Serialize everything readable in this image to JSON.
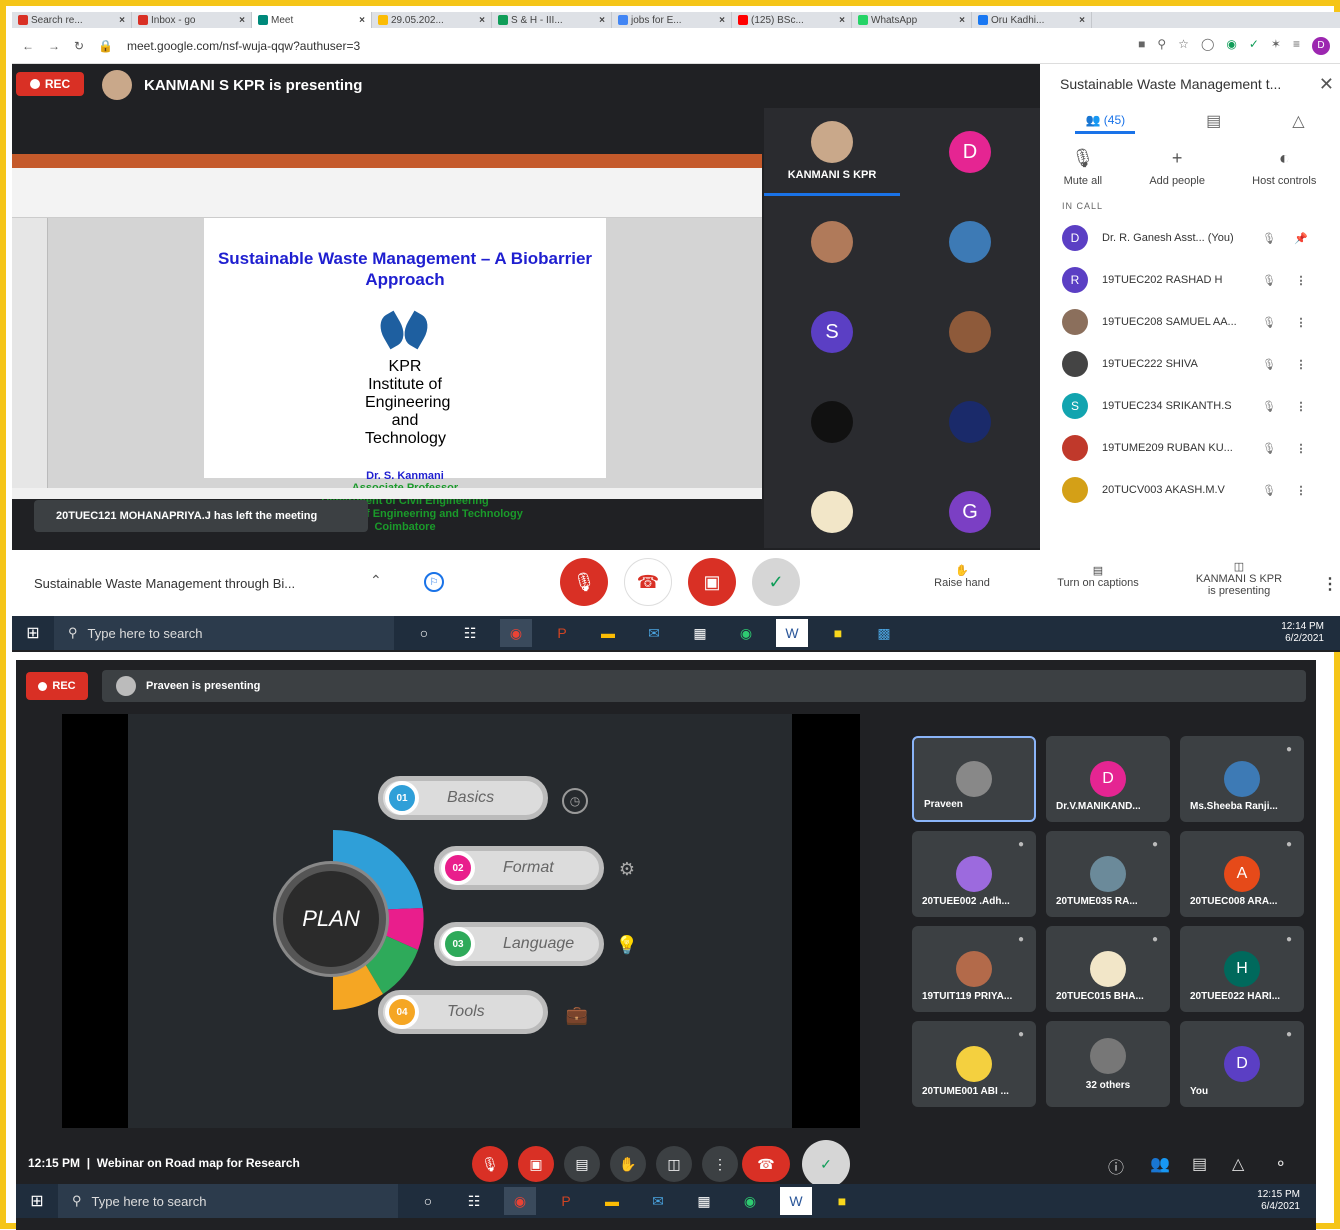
{
  "browser": {
    "tabs": [
      {
        "label": "Search re...",
        "color": "#d93025"
      },
      {
        "label": "Inbox - go",
        "color": "#d93025"
      },
      {
        "label": "Meet",
        "color": "#00897b"
      },
      {
        "label": "29.05.202...",
        "color": "#fbbc04"
      },
      {
        "label": "S & H - III...",
        "color": "#0f9d58"
      },
      {
        "label": "jobs for E...",
        "color": "#4285f4"
      },
      {
        "label": "(125) BSc...",
        "color": "#ff0000"
      },
      {
        "label": "WhatsApp",
        "color": "#25d366"
      },
      {
        "label": "Oru Kadhi...",
        "color": "#1877f2"
      }
    ],
    "url": "meet.google.com/nsf-wuja-qqw?authuser=3"
  },
  "top": {
    "rec_label": "REC",
    "presenting_text": "KANMANI S KPR is presenting",
    "slide": {
      "title": "Sustainable Waste Management – A Biobarrier Approach",
      "institute_logo_text": "KPR Institute of Engineering and Technology",
      "presenter": "Dr. S. Kanmani",
      "lines": [
        "Associate Professor",
        "Department of Civil Engineering",
        "KPR Institute of Engineering and Technology",
        "Coimbatore"
      ]
    },
    "notification": "20TUEC121 MOHANAPRIYA.J has left the meeting",
    "grid": [
      {
        "label": "KANMANI S KPR",
        "initial": "",
        "color": "#c9a88a"
      },
      {
        "label": "",
        "initial": "D",
        "color": "#e52592"
      },
      {
        "label": "",
        "initial": "",
        "color": "#b07a5a"
      },
      {
        "label": "",
        "initial": "",
        "color": "#3d7ab5"
      },
      {
        "label": "",
        "initial": "S",
        "color": "#5b3fc4"
      },
      {
        "label": "",
        "initial": "",
        "color": "#8e5a3a"
      },
      {
        "label": "",
        "initial": "",
        "color": "#111111"
      },
      {
        "label": "",
        "initial": "",
        "color": "#1a2a6a"
      },
      {
        "label": "",
        "initial": "",
        "color": "#f2e6c8"
      },
      {
        "label": "",
        "initial": "G",
        "color": "#7b3fc4"
      }
    ],
    "panel": {
      "title": "Sustainable Waste Management t...",
      "people_count": "(45)",
      "actions": [
        "Mute all",
        "Add people",
        "Host controls"
      ],
      "in_call_label": "IN CALL",
      "participants": [
        {
          "name": "Dr. R. Ganesh Asst... (You)",
          "initial": "D",
          "color": "#5b3fc4"
        },
        {
          "name": "19TUEC202 RASHAD H",
          "initial": "R",
          "color": "#5b3fc4"
        },
        {
          "name": "19TUEC208 SAMUEL AA...",
          "initial": "",
          "color": "#8b6f5c"
        },
        {
          "name": "19TUEC222 SHIVA",
          "initial": "",
          "color": "#444444"
        },
        {
          "name": "19TUEC234 SRIKANTH.S",
          "initial": "S",
          "color": "#12a4af"
        },
        {
          "name": "19TUME209 RUBAN KU...",
          "initial": "",
          "color": "#c0392b"
        },
        {
          "name": "20TUCV003 AKASH.M.V",
          "initial": "",
          "color": "#d4a017"
        }
      ]
    },
    "controls": {
      "meeting_title": "Sustainable Waste Management through Bi...",
      "raise_hand": "Raise hand",
      "captions": "Turn on captions",
      "presenting_line1": "KANMANI S KPR",
      "presenting_line2": "is presenting"
    },
    "taskbar": {
      "search_placeholder": "Type here to search",
      "time": "12:14 PM",
      "date": "6/2/2021"
    }
  },
  "bottom": {
    "rec_label": "REC",
    "presenting_text": "Praveen is presenting",
    "plan_center": "PLAN",
    "plan_items": [
      {
        "num": "01",
        "label": "Basics",
        "color": "#2f9fd8"
      },
      {
        "num": "02",
        "label": "Format",
        "color": "#e91e8c"
      },
      {
        "num": "03",
        "label": "Language",
        "color": "#2eaa5a"
      },
      {
        "num": "04",
        "label": "Tools",
        "color": "#f5a623"
      }
    ],
    "tiles": [
      {
        "name": "Praveen",
        "initial": "",
        "color": "#888888"
      },
      {
        "name": "Dr.V.MANIKAND...",
        "initial": "D",
        "color": "#e52592"
      },
      {
        "name": "Ms.Sheeba Ranji...",
        "initial": "",
        "color": "#3d7ab5"
      },
      {
        "name": "20TUEE002 .Adh...",
        "initial": "",
        "color": "#9c6ade"
      },
      {
        "name": "20TUME035 RA...",
        "initial": "",
        "color": "#6b8a9a"
      },
      {
        "name": "20TUEC008 ARA...",
        "initial": "A",
        "color": "#e64a19"
      },
      {
        "name": "19TUIT119 PRIYA...",
        "initial": "",
        "color": "#b36a4a"
      },
      {
        "name": "20TUEC015 BHA...",
        "initial": "",
        "color": "#f2e6c8"
      },
      {
        "name": "20TUEE022 HARI...",
        "initial": "H",
        "color": "#00695c"
      },
      {
        "name": "20TUME001 ABI ...",
        "initial": "",
        "color": "#f4d03f"
      },
      {
        "name": "32 others",
        "initial": "",
        "color": "#777777"
      },
      {
        "name": "You",
        "initial": "D",
        "color": "#5b3fc4"
      }
    ],
    "time": "12:15 PM",
    "meeting_title": "Webinar on Road map for Research",
    "taskbar": {
      "search_placeholder": "Type here to search",
      "time": "12:15 PM",
      "date": "6/4/2021"
    }
  }
}
